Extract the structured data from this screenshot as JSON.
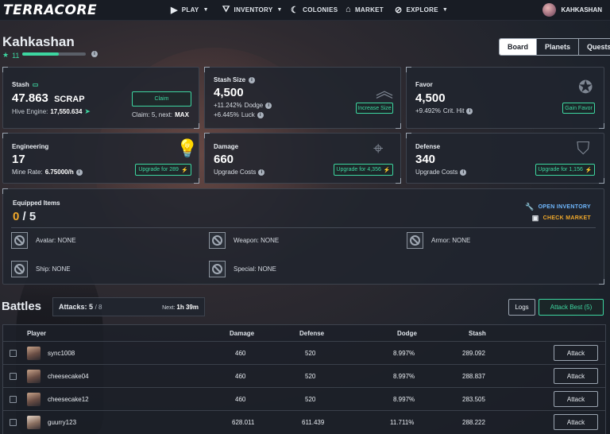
{
  "nav": {
    "logo": "TERRACORE",
    "items": [
      {
        "label": "PLAY",
        "icon": "play-icon",
        "caret": true
      },
      {
        "label": "INVENTORY",
        "icon": "inventory-icon",
        "caret": true
      },
      {
        "label": "COLONIES",
        "icon": "colonies-icon",
        "caret": false
      },
      {
        "label": "MARKET",
        "icon": "market-icon",
        "caret": false
      },
      {
        "label": "EXPLORE",
        "icon": "explore-icon",
        "caret": true
      }
    ],
    "username": "KAHKASHAN"
  },
  "profile": {
    "name": "Kahkashan",
    "level": "11",
    "level_progress": 0.58
  },
  "tabs": [
    "Board",
    "Planets",
    "Quests"
  ],
  "active_tab": "Board",
  "stash": {
    "title": "Stash",
    "value": "47.863",
    "unit": "SCRAP",
    "hive_label": "Hive Engine:",
    "hive_value": "17,550.634",
    "claim_button": "Claim",
    "claim_info_prefix": "Claim: 5, next:",
    "claim_info_value": "MAX"
  },
  "stash_size": {
    "title": "Stash Size",
    "value": "4,500",
    "line1_value": "+11.242%",
    "line1_label": "Dodge",
    "line2_value": "+6.445%",
    "line2_label": "Luck",
    "button": "Increase Size"
  },
  "favor": {
    "title": "Favor",
    "value": "4,500",
    "line1_value": "+9.492%",
    "line1_label": "Crit. Hit",
    "button": "Gain Favor"
  },
  "engineering": {
    "title": "Engineering",
    "value": "17",
    "sub_label": "Mine Rate:",
    "sub_value": "6.75000/h",
    "button": "Upgrade for 289"
  },
  "damage": {
    "title": "Damage",
    "value": "660",
    "sub_label": "Upgrade Costs",
    "button": "Upgrade for 4,356"
  },
  "defense": {
    "title": "Defense",
    "value": "340",
    "sub_label": "Upgrade Costs",
    "button": "Upgrade for 1,156"
  },
  "equipped": {
    "title": "Equipped Items",
    "current": "0",
    "separator": "/",
    "total": "5",
    "open_inventory": "OPEN INVENTORY",
    "check_market": "CHECK MARKET",
    "slots": [
      {
        "label": "Avatar: NONE"
      },
      {
        "label": "Weapon: NONE"
      },
      {
        "label": "Armor: NONE"
      },
      {
        "label": "Ship: NONE"
      },
      {
        "label": "Special: NONE"
      }
    ]
  },
  "battles": {
    "title": "Battles",
    "attacks_label": "Attacks:",
    "attacks_current": "5",
    "attacks_max": "/ 8",
    "next_label": "Next:",
    "next_value": "1h 39m",
    "logs_button": "Logs",
    "attack_best_button": "Attack Best (5)",
    "columns": [
      "Player",
      "Damage",
      "Defense",
      "Dodge",
      "Stash"
    ],
    "rows": [
      {
        "player": "sync1008",
        "damage": "460",
        "defense": "520",
        "dodge": "8.997%",
        "stash": "289.092",
        "action": "Attack"
      },
      {
        "player": "cheesecake04",
        "damage": "460",
        "defense": "520",
        "dodge": "8.997%",
        "stash": "288.837",
        "action": "Attack"
      },
      {
        "player": "cheesecake12",
        "damage": "460",
        "defense": "520",
        "dodge": "8.997%",
        "stash": "283.505",
        "action": "Attack"
      },
      {
        "player": "guurry123",
        "damage": "628.011",
        "defense": "611.439",
        "dodge": "11.711%",
        "stash": "288.222",
        "action": "Attack"
      }
    ]
  },
  "colors": {
    "accent": "#3dd6a0",
    "highlight": "#f0a82a",
    "panel": "#20252e"
  }
}
